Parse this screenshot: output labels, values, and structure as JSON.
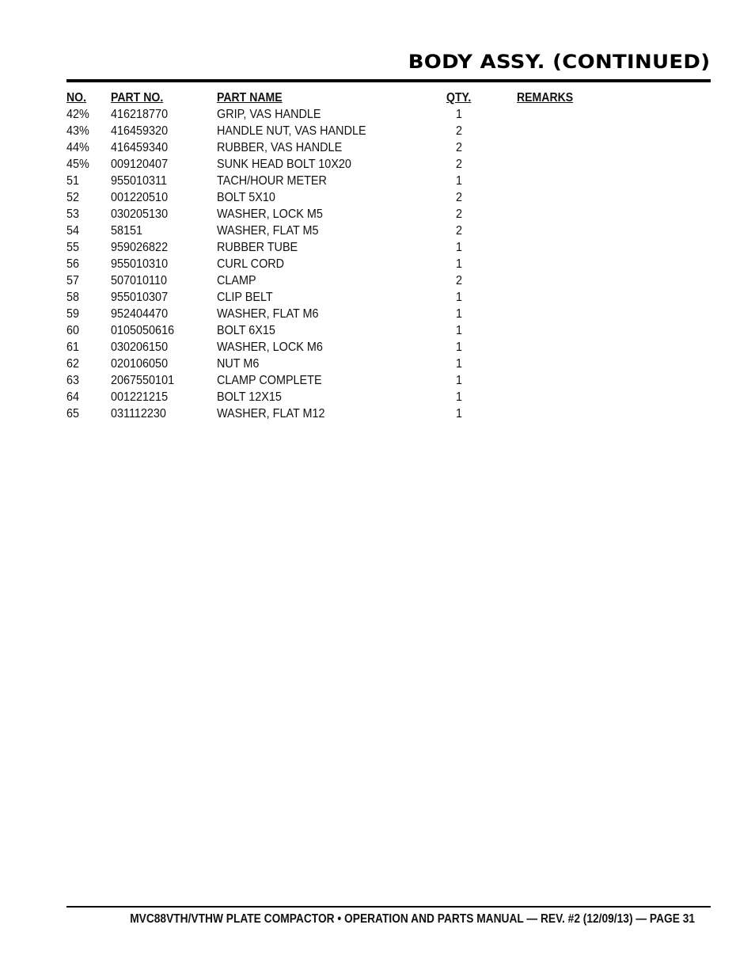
{
  "header": {
    "title": "BODY ASSY. (CONTINUED)"
  },
  "table": {
    "columns": {
      "no": "NO.",
      "part_no": "PART NO.",
      "part_name": "PART NAME",
      "qty": "QTY.",
      "remarks": "REMARKS"
    },
    "rows": [
      {
        "no": "42%",
        "part_no": "416218770",
        "part_name": "GRIP, VAS HANDLE",
        "qty": "1",
        "remarks": ""
      },
      {
        "no": "43%",
        "part_no": "416459320",
        "part_name": "HANDLE NUT, VAS HANDLE",
        "qty": "2",
        "remarks": ""
      },
      {
        "no": "44%",
        "part_no": "416459340",
        "part_name": "RUBBER, VAS HANDLE",
        "qty": "2",
        "remarks": ""
      },
      {
        "no": "45%",
        "part_no": "009120407",
        "part_name": "SUNK HEAD BOLT 10X20",
        "qty": "2",
        "remarks": ""
      },
      {
        "no": "51",
        "part_no": "955010311",
        "part_name": "TACH/HOUR METER",
        "qty": "1",
        "remarks": ""
      },
      {
        "no": "52",
        "part_no": "001220510",
        "part_name": "BOLT 5X10",
        "qty": "2",
        "remarks": ""
      },
      {
        "no": "53",
        "part_no": "030205130",
        "part_name": "WASHER, LOCK M5",
        "qty": "2",
        "remarks": ""
      },
      {
        "no": "54",
        "part_no": "58151",
        "part_name": "WASHER, FLAT M5",
        "qty": "2",
        "remarks": ""
      },
      {
        "no": "55",
        "part_no": "959026822",
        "part_name": "RUBBER TUBE",
        "qty": "1",
        "remarks": ""
      },
      {
        "no": "56",
        "part_no": "955010310",
        "part_name": "CURL CORD",
        "qty": "1",
        "remarks": ""
      },
      {
        "no": "57",
        "part_no": "507010110",
        "part_name": "CLAMP",
        "qty": "2",
        "remarks": ""
      },
      {
        "no": "58",
        "part_no": "955010307",
        "part_name": "CLIP BELT",
        "qty": "1",
        "remarks": ""
      },
      {
        "no": "59",
        "part_no": "952404470",
        "part_name": "WASHER, FLAT M6",
        "qty": "1",
        "remarks": ""
      },
      {
        "no": "60",
        "part_no": "0105050616",
        "part_name": "BOLT 6X15",
        "qty": "1",
        "remarks": ""
      },
      {
        "no": "61",
        "part_no": "030206150",
        "part_name": "WASHER, LOCK M6",
        "qty": "1",
        "remarks": ""
      },
      {
        "no": "62",
        "part_no": "020106050",
        "part_name": "NUT M6",
        "qty": "1",
        "remarks": ""
      },
      {
        "no": "63",
        "part_no": "2067550101",
        "part_name": "CLAMP COMPLETE",
        "qty": "1",
        "remarks": ""
      },
      {
        "no": "64",
        "part_no": "001221215",
        "part_name": "BOLT 12X15",
        "qty": "1",
        "remarks": ""
      },
      {
        "no": "65",
        "part_no": "031112230",
        "part_name": "WASHER, FLAT M12",
        "qty": "1",
        "remarks": ""
      }
    ]
  },
  "footer": {
    "text": "MVC88VTH/VTHW PLATE COMPACTOR • OPERATION AND PARTS MANUAL — REV. #2 (12/09/13) — PAGE 31"
  }
}
